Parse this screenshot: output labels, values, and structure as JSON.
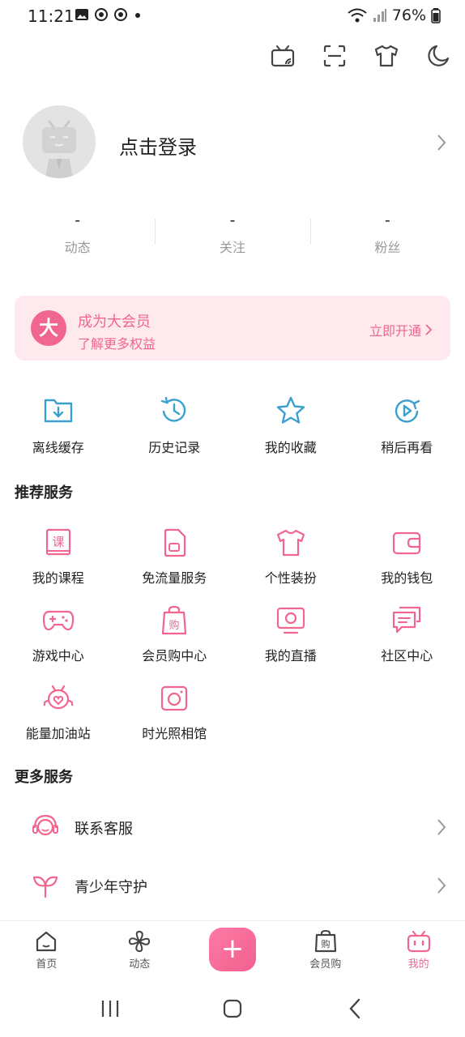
{
  "status": {
    "time": "11:21",
    "battery": "76%"
  },
  "profile": {
    "login_label": "点击登录"
  },
  "stats": [
    {
      "value": "-",
      "label": "动态"
    },
    {
      "value": "-",
      "label": "关注"
    },
    {
      "value": "-",
      "label": "粉丝"
    }
  ],
  "vip": {
    "logo_char": "大",
    "title": "成为大会员",
    "subtitle": "了解更多权益",
    "cta": "立即开通"
  },
  "quick_actions": [
    {
      "label": "离线缓存",
      "icon": "offline-cache-icon"
    },
    {
      "label": "历史记录",
      "icon": "history-icon"
    },
    {
      "label": "我的收藏",
      "icon": "star-icon"
    },
    {
      "label": "稍后再看",
      "icon": "watch-later-icon"
    }
  ],
  "recommended": {
    "title": "推荐服务",
    "items": [
      {
        "label": "我的课程",
        "icon": "course-icon"
      },
      {
        "label": "免流量服务",
        "icon": "sim-card-icon"
      },
      {
        "label": "个性装扮",
        "icon": "tshirt-icon"
      },
      {
        "label": "我的钱包",
        "icon": "wallet-icon"
      },
      {
        "label": "游戏中心",
        "icon": "gamepad-icon"
      },
      {
        "label": "会员购中心",
        "icon": "shopping-bag-icon"
      },
      {
        "label": "我的直播",
        "icon": "live-tv-icon"
      },
      {
        "label": "社区中心",
        "icon": "chat-icon"
      },
      {
        "label": "能量加油站",
        "icon": "energy-station-icon"
      },
      {
        "label": "时光照相馆",
        "icon": "camera-icon"
      }
    ]
  },
  "more_services": {
    "title": "更多服务",
    "items": [
      {
        "label": "联系客服",
        "icon": "headset-icon"
      },
      {
        "label": "青少年守护",
        "icon": "sprout-icon"
      }
    ]
  },
  "tabs": [
    {
      "label": "首页",
      "icon": "home-icon"
    },
    {
      "label": "动态",
      "icon": "pinwheel-icon"
    },
    {
      "label": "",
      "icon": "plus-icon"
    },
    {
      "label": "会员购",
      "icon": "shopping-bag-icon"
    },
    {
      "label": "我的",
      "icon": "tv-mascot-icon"
    }
  ],
  "colors": {
    "accent": "#f0668f",
    "blue_icon": "#3aa0d0",
    "banner_bg": "#fde9ee"
  }
}
